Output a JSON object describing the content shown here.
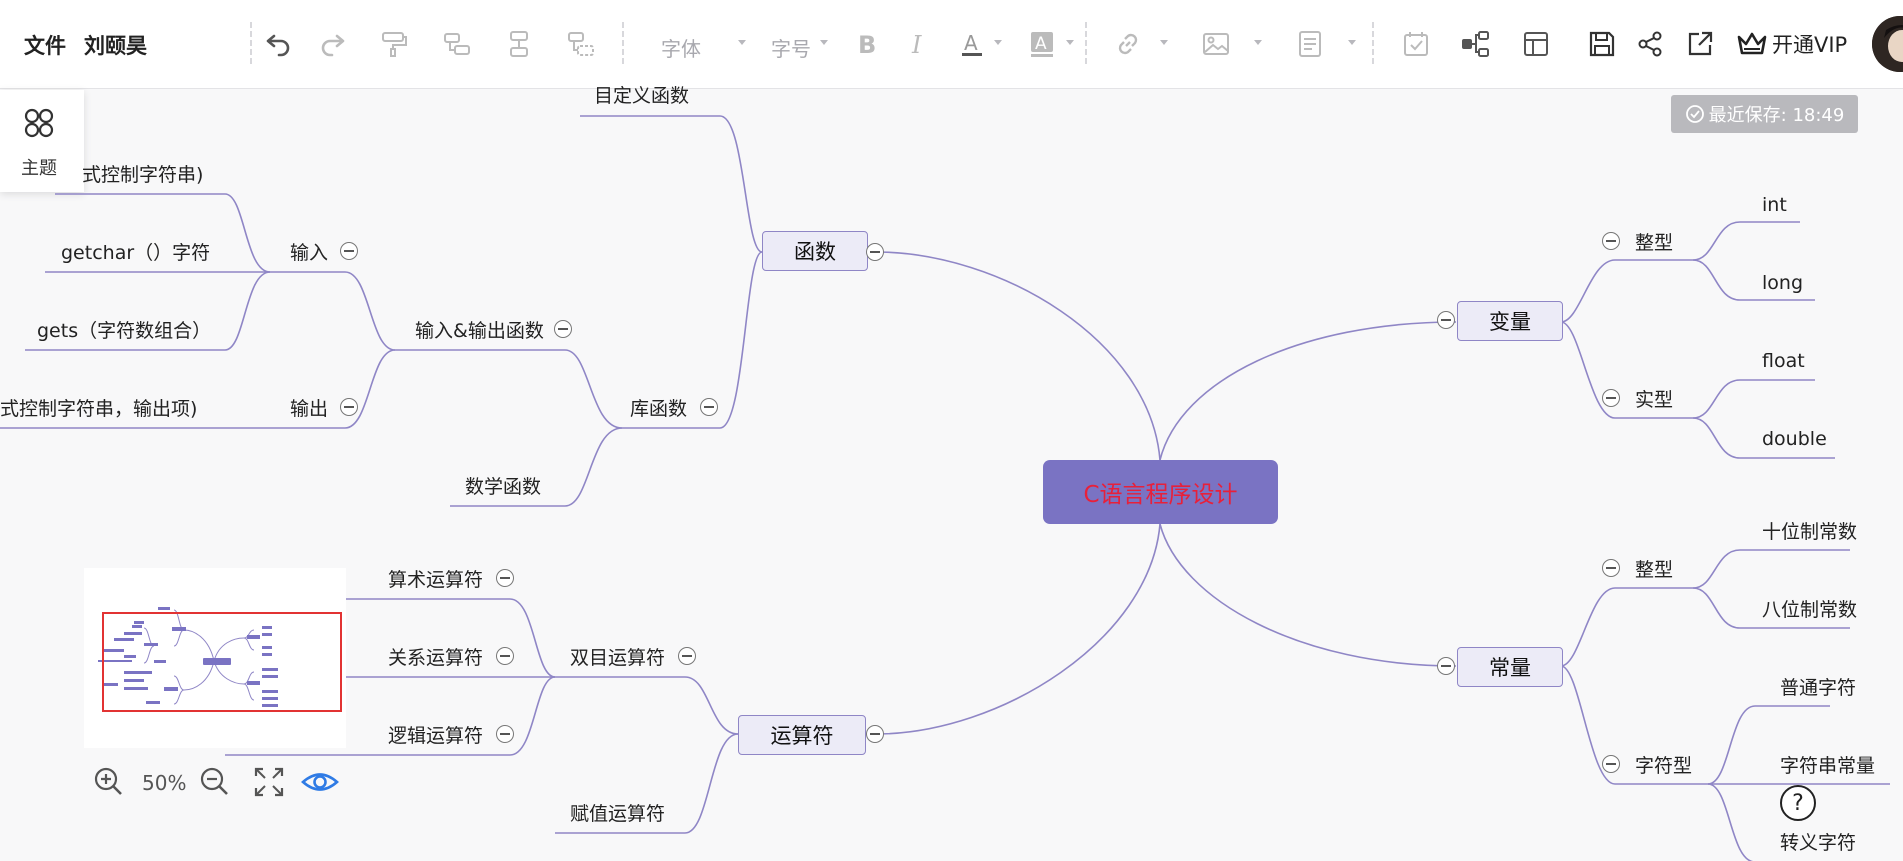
{
  "header": {
    "file_label": "文件",
    "user_name": "刘颐昊",
    "font_family_label": "字体",
    "font_size_label": "字号",
    "vip_label": "开通VIP"
  },
  "theme_panel": {
    "label": "主题"
  },
  "save_status": "最近保存: 18:49",
  "zoom": {
    "value": "50%"
  },
  "mindmap": {
    "root": "C语言程序设计",
    "functions": "函数",
    "custom_functions": "目定义函数",
    "library_functions": "库函数",
    "io_functions": "输入&输出函数",
    "math_functions": "数学函数",
    "input": "输入",
    "output": "输出",
    "scanf_partial": "式控制字符串)",
    "getchar": "getchar（）字符",
    "gets": "gets（字符数组合）",
    "printf_partial": "式控制字符串，输出项)",
    "operators": "运算符",
    "binary_operators": "双目运算符",
    "arithmetic_operators": "算术运算符",
    "relational_operators": "关系运算符",
    "logical_operators": "逻辑运算符",
    "assignment_operators": "赋值运算符",
    "variables": "变量",
    "integer_type": "整型",
    "int": "int",
    "long": "long",
    "real_type": "实型",
    "float": "float",
    "double": "double",
    "constants": "常量",
    "integer_const": "整型",
    "decimal_const": "十位制常数",
    "octal_const": "八位制常数",
    "char_type": "字符型",
    "normal_char": "普通字符",
    "string_const": "字符串常量",
    "escape_char": "转义字符"
  },
  "colors": {
    "root_fill": "#7a73c3",
    "root_text": "#e8203a",
    "branch_line": "#8f86c6",
    "node_fill": "#ecebf7",
    "accent_blue": "#2f7be5",
    "minimap_frame": "#e23333"
  }
}
